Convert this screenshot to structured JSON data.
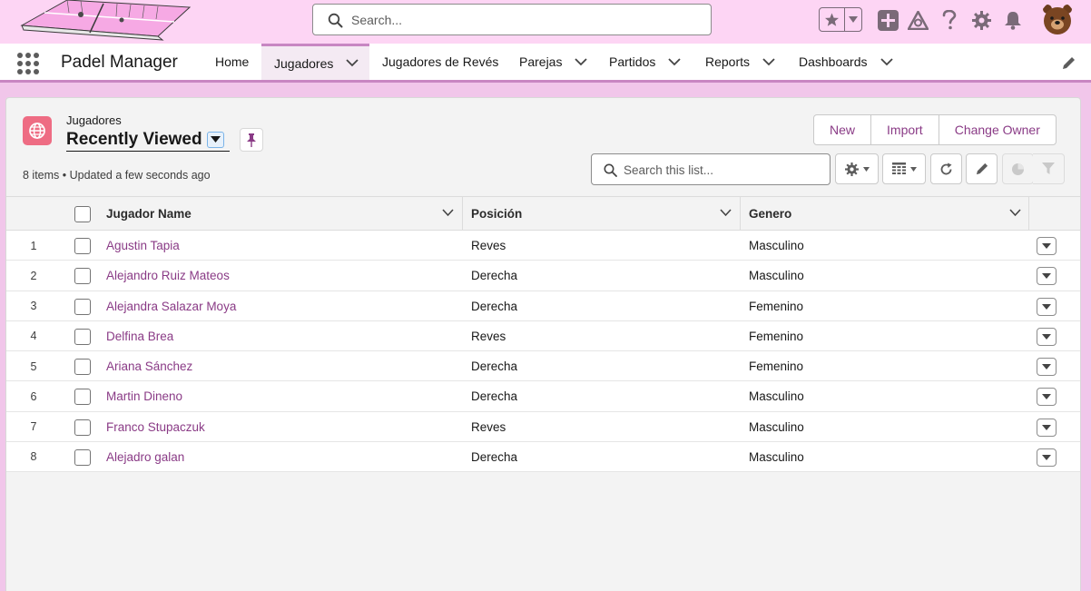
{
  "global": {
    "search_placeholder": "Search..."
  },
  "nav": {
    "app_name": "Padel Manager",
    "items": [
      {
        "label": "Home"
      },
      {
        "label": "Jugadores"
      },
      {
        "label": "Jugadores de Revés"
      },
      {
        "label": "Parejas"
      },
      {
        "label": "Partidos"
      },
      {
        "label": "Reports"
      },
      {
        "label": "Dashboards"
      }
    ]
  },
  "list_header": {
    "object_label": "Jugadores",
    "view_name": "Recently Viewed",
    "meta": "8 items • Updated a few seconds ago",
    "buttons": {
      "new": "New",
      "import": "Import",
      "change_owner": "Change Owner"
    },
    "search_placeholder": "Search this list..."
  },
  "table": {
    "columns": [
      "Jugador Name",
      "Posición",
      "Genero"
    ],
    "rows": [
      {
        "num": "1",
        "name": "Agustin Tapia",
        "posicion": "Reves",
        "genero": "Masculino"
      },
      {
        "num": "2",
        "name": "Alejandro Ruiz Mateos",
        "posicion": "Derecha",
        "genero": "Masculino"
      },
      {
        "num": "3",
        "name": "Alejandra Salazar Moya",
        "posicion": "Derecha",
        "genero": "Femenino"
      },
      {
        "num": "4",
        "name": "Delfina Brea",
        "posicion": "Reves",
        "genero": "Femenino"
      },
      {
        "num": "5",
        "name": "Ariana Sánchez",
        "posicion": "Derecha",
        "genero": "Femenino"
      },
      {
        "num": "6",
        "name": "Martin Dineno",
        "posicion": "Derecha",
        "genero": "Masculino"
      },
      {
        "num": "7",
        "name": "Franco Stupaczuk",
        "posicion": "Reves",
        "genero": "Masculino"
      },
      {
        "num": "8",
        "name": "Alejadro galan",
        "posicion": "Derecha",
        "genero": "Masculino"
      }
    ]
  },
  "colors": {
    "header_bg": "#fdd5f4",
    "accent": "#c886c2",
    "link": "#8a3b86",
    "object_icon": "#ee6c83",
    "icon_gray": "#7a6a78"
  },
  "icons": [
    "search-icon",
    "star-icon",
    "add-icon",
    "trailhead-icon",
    "help-icon",
    "setup-gear-icon",
    "bell-icon",
    "app-launcher-icon",
    "edit-pencil-icon",
    "globe-icon",
    "pin-icon",
    "refresh-icon",
    "chart-icon",
    "filter-icon",
    "table-view-icon"
  ]
}
